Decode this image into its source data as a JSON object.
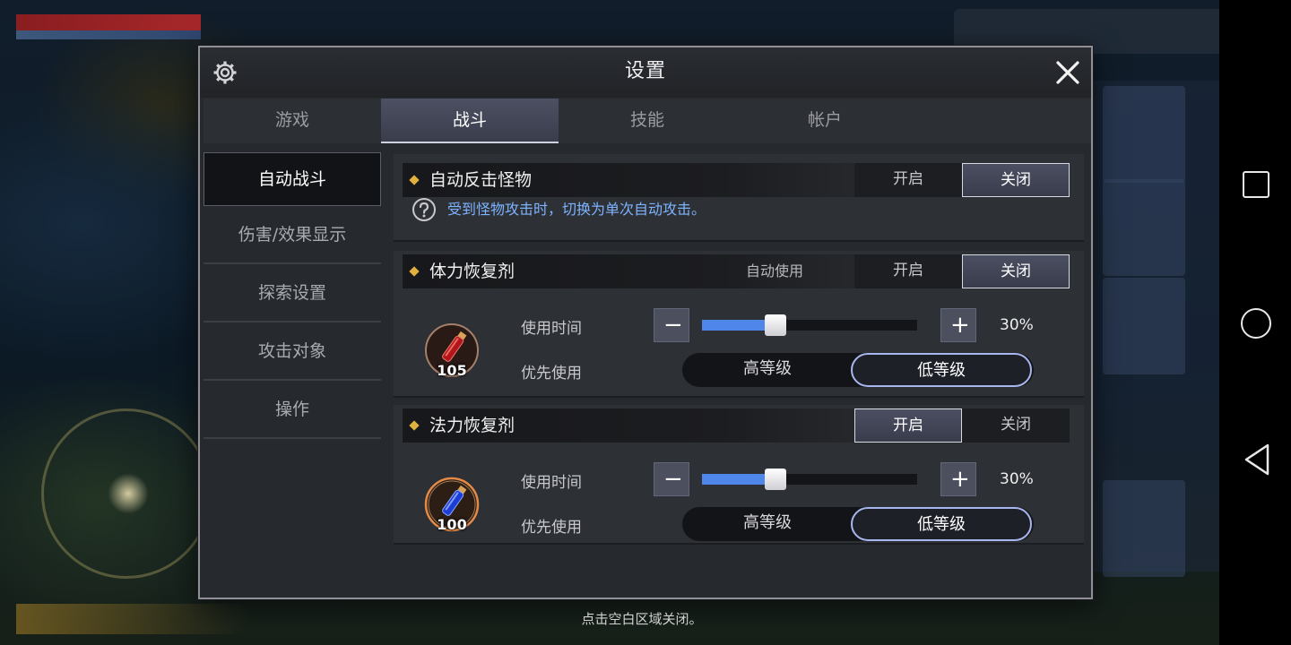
{
  "dialog": {
    "title": "设置",
    "tabs": [
      {
        "label": "游戏"
      },
      {
        "label": "战斗",
        "active": true
      },
      {
        "label": "技能"
      },
      {
        "label": "帐户"
      }
    ],
    "sidebar": [
      {
        "label": "自动战斗",
        "active": true
      },
      {
        "label": "伤害/效果显示"
      },
      {
        "label": "探索设置"
      },
      {
        "label": "攻击对象"
      },
      {
        "label": "操作"
      }
    ]
  },
  "sections": {
    "counter": {
      "title": "自动反击怪物",
      "on_label": "开启",
      "off_label": "关闭",
      "selected": "off",
      "help": "受到怪物攻击时，切换为单次自动攻击。"
    },
    "hp_potion": {
      "title": "体力恢复剂",
      "auto_label": "自动使用",
      "on_label": "开启",
      "off_label": "关闭",
      "selected": "off",
      "count": "105",
      "use_time_label": "使用时间",
      "use_time_value": 30,
      "use_time_text": "30%",
      "priority_label": "优先使用",
      "priority_high": "高等级",
      "priority_low": "低等级",
      "priority_selected": "low"
    },
    "mp_potion": {
      "title": "法力恢复剂",
      "on_label": "开启",
      "off_label": "关闭",
      "selected": "on",
      "count": "100",
      "use_time_label": "使用时间",
      "use_time_value": 30,
      "use_time_text": "30%",
      "priority_label": "优先使用",
      "priority_high": "高等级",
      "priority_low": "低等级",
      "priority_selected": "low"
    }
  },
  "footer_hint": "点击空白区域关闭。",
  "icons": {
    "settings": "gear-icon",
    "close": "close-icon",
    "help": "question-icon",
    "decrease": "minus-icon",
    "increase": "plus-icon",
    "hp_potion": "red-potion-icon",
    "mp_potion": "blue-potion-icon"
  },
  "colors": {
    "accent_blue": "#4f86ea",
    "help_text": "#7eb4ff",
    "diamond": "#e1b140",
    "priority_border": "#a8b6ee"
  }
}
